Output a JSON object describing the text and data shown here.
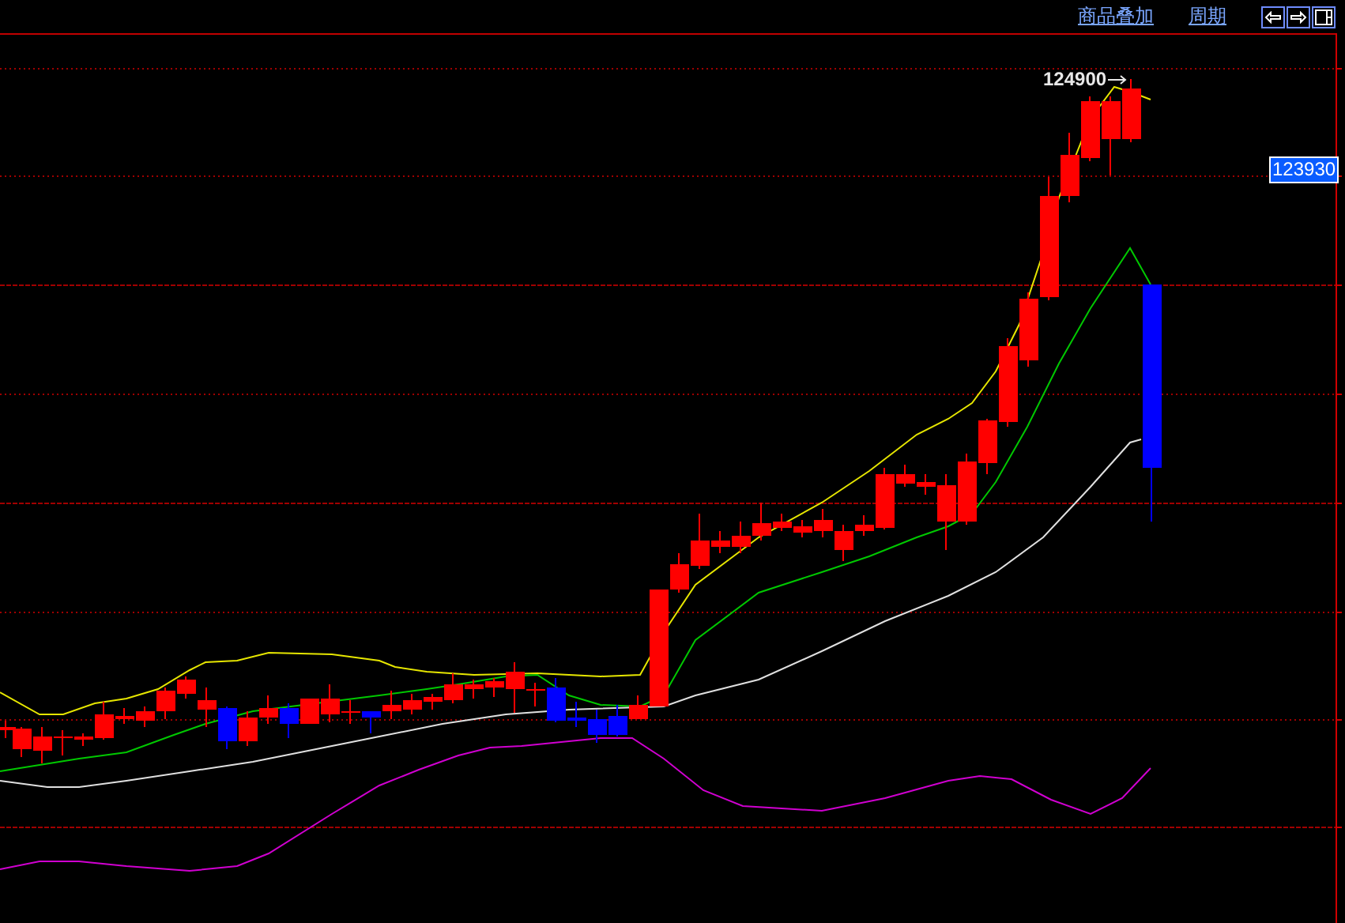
{
  "toolbar": {
    "links": [
      {
        "label": "商品叠加"
      },
      {
        "label": "周期"
      }
    ]
  },
  "chart": {
    "high_label": "124900",
    "last_price": "123930"
  }
}
